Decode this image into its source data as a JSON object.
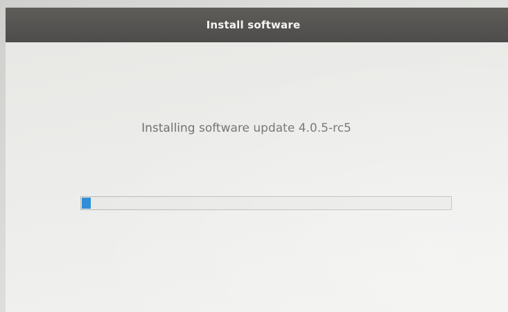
{
  "window": {
    "title": "Install software"
  },
  "install": {
    "status_text": "Installing software update 4.0.5-rc5",
    "progress": {
      "fraction": 0.025,
      "color": "#2f8ed8"
    }
  },
  "colors": {
    "title_bar": "#4e4c4a",
    "screen_background": "#ececea",
    "status_text": "#6f6f6d"
  }
}
